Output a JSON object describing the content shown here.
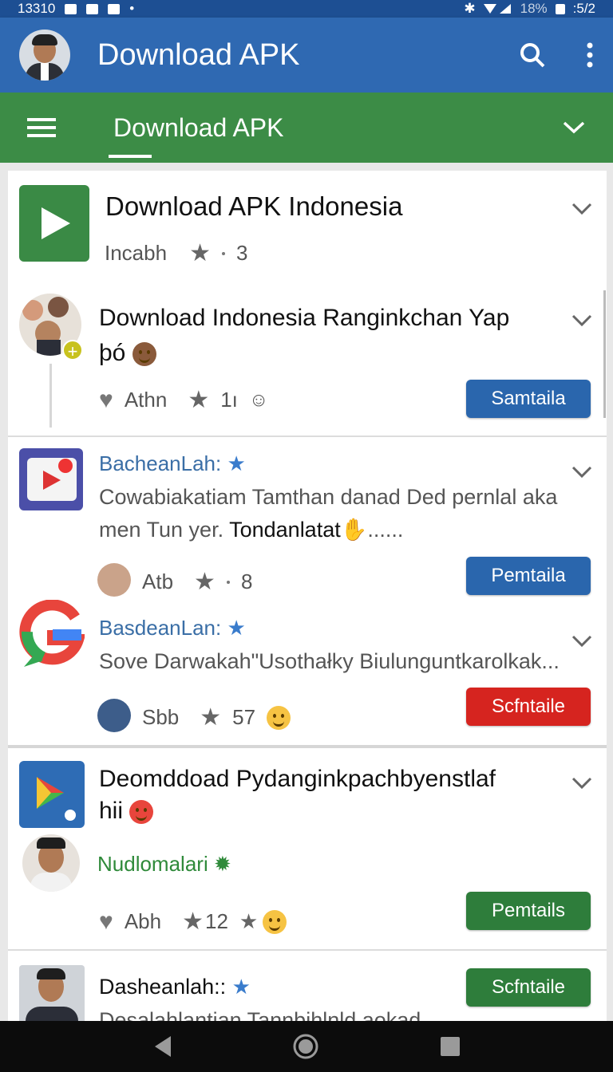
{
  "status": {
    "time": "13310",
    "battery": "18%",
    "clock": ":5/2"
  },
  "appbar": {
    "title": "Download APK"
  },
  "tabbar": {
    "tab_label": "Download APK"
  },
  "cards": [
    {
      "title": "Download APK Indonesia",
      "meta_label": "Incabh",
      "meta_count": "3"
    },
    {
      "title_line1": "Download Indonesia Ranginkchan Yap",
      "title_line2": "þó",
      "meta_label": "Athn",
      "meta_count": "1ı",
      "button": "Samtaila"
    },
    {
      "author": "BacheanLah:",
      "desc_line1": "Cowabiakatiam Tamthan danad Ded pernlal aka",
      "desc_line2a": "men Tun yer.",
      "desc_line2b": " Tondanlatat",
      "desc_line2c": "......",
      "meta_label": "Atb",
      "meta_count": "8",
      "button": "Pemtaila"
    },
    {
      "author": "BasdeanLan:",
      "desc": "Sove Darwakah\"Usothałky Biulunguntkarolkak...",
      "meta_label": "Sbb",
      "meta_count": "57",
      "button": "Scfntaile"
    },
    {
      "title_line1": "Deomddoad Pydanginkpachbyenstlaf",
      "title_line2": "hii",
      "author": "Nudlomalari",
      "meta_label": "Abh",
      "meta_count": "12",
      "button": "Pemtails"
    },
    {
      "author": "Dasheanlah::",
      "desc": "Desalahlantian Tannbihlnld aokad.....",
      "button": "Scfntaile"
    }
  ],
  "colors": {
    "appbar": "#2f69b2",
    "tabbar": "#3c8c46",
    "blue_button": "#2a66ad",
    "red_button": "#d6241f",
    "green_button": "#2e7d3b"
  }
}
